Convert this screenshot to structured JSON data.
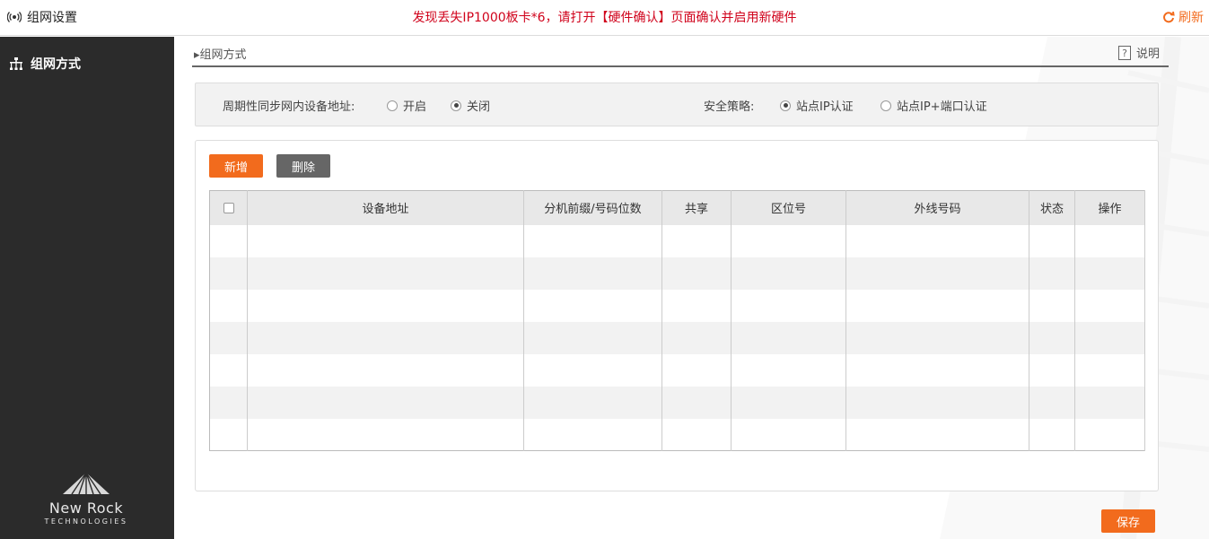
{
  "header": {
    "title": "组网设置",
    "notice": "发现丢失IP1000板卡*6，请打开【硬件确认】页面确认并启用新硬件",
    "refresh_label": "刷新"
  },
  "sidebar": {
    "items": [
      {
        "label": "组网方式",
        "icon": "network-icon",
        "active": true
      }
    ],
    "logo": {
      "brand": "New Rock",
      "sub": "TECHNOLOGIES"
    }
  },
  "breadcrumb": {
    "label": "▸组网方式",
    "help_label": "说明"
  },
  "options": {
    "sync_label": "周期性同步网内设备地址:",
    "sync_choices": [
      {
        "label": "开启",
        "checked": false
      },
      {
        "label": "关闭",
        "checked": true
      }
    ],
    "security_label": "安全策略:",
    "security_choices": [
      {
        "label": "站点IP认证",
        "checked": true
      },
      {
        "label": "站点IP+端口认证",
        "checked": false
      }
    ]
  },
  "toolbar": {
    "add_label": "新增",
    "delete_label": "删除"
  },
  "table": {
    "columns": [
      "",
      "设备地址",
      "分机前缀/号码位数",
      "共享",
      "区位号",
      "外线号码",
      "状态",
      "操作"
    ],
    "rows": []
  },
  "footer": {
    "save_label": "保存"
  },
  "colors": {
    "accent": "#f26b1d",
    "sidebar": "#2b2b2b",
    "notice": "#d0021b"
  }
}
